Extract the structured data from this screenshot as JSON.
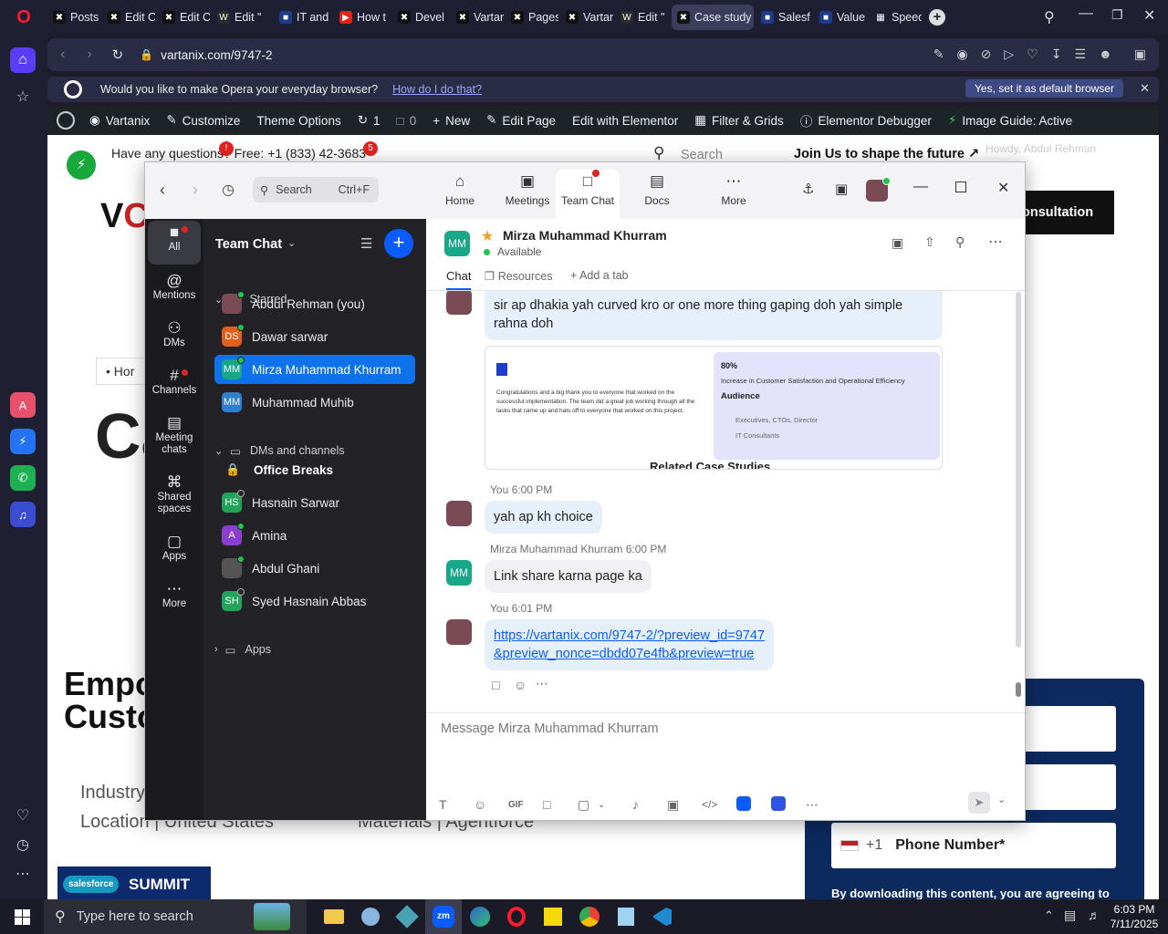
{
  "browser": {
    "tabs": [
      {
        "label": "Posts",
        "icon": "x-icon"
      },
      {
        "label": "Edit C",
        "icon": "x-icon"
      },
      {
        "label": "Edit C",
        "icon": "x-icon"
      },
      {
        "label": "Edit \"",
        "icon": "wordpress-icon"
      },
      {
        "label": "IT and",
        "icon": "page-icon"
      },
      {
        "label": "How t",
        "icon": "youtube-icon"
      },
      {
        "label": "Devel",
        "icon": "x-icon"
      },
      {
        "label": "Vartar",
        "icon": "x-icon"
      },
      {
        "label": "Pages",
        "icon": "x-icon"
      },
      {
        "label": "Vartar",
        "icon": "x-icon"
      },
      {
        "label": "Edit \"",
        "icon": "wordpress-icon"
      },
      {
        "label": "Case study",
        "icon": "x-icon"
      },
      {
        "label": "Salesf",
        "icon": "page-icon"
      },
      {
        "label": "Value",
        "icon": "page-icon"
      },
      {
        "label": "Speed",
        "icon": "grid-icon"
      }
    ],
    "url": "vartanix.com/9747-2",
    "banner_text": "Would you like to make Opera your everyday browser?",
    "banner_link": "How do I do that?",
    "banner_button": "Yes, set it as default browser"
  },
  "wp_admin": {
    "items": [
      "Vartanix",
      "Customize",
      "Theme Options",
      "1",
      "0",
      "New",
      "Edit Page",
      "Edit with Elementor",
      "Filter & Grids",
      "Elementor Debugger",
      "Image Guide: Active"
    ]
  },
  "site": {
    "top_text": "Have any questions? Free: +1 (833) 4",
    "phone_tail": "2-3683",
    "badge_1": "!",
    "badge_2": "5",
    "search_placeholder": "Search",
    "join": "Join Us to shape the future",
    "howdy": "Howdy, Abdul Rehman",
    "consultation": "onsultation",
    "home": "Hor",
    "big_c": "Ca",
    "empo": "Empo",
    "custo": "Custo",
    "industry": "Industry",
    "location": "Location | United States",
    "materials": "Materials | Agentforce",
    "phone_prefix": "+1",
    "phone_label": "Phone Number*",
    "disclaimer": "By downloading this content, you are agreeing to",
    "summit_brand": "salesforce",
    "summit": "SUMMIT"
  },
  "zoom": {
    "search_placeholder": "Search",
    "search_shortcut": "Ctrl+F",
    "nav": [
      {
        "label": "Home",
        "icon": "home-icon"
      },
      {
        "label": "Meetings",
        "icon": "video-icon"
      },
      {
        "label": "Team Chat",
        "icon": "chat-icon"
      },
      {
        "label": "Docs",
        "icon": "docs-icon"
      },
      {
        "label": "More",
        "icon": "more-icon"
      }
    ],
    "rail": [
      {
        "label": "All",
        "icon": "chat-bubble-icon"
      },
      {
        "label": "Mentions",
        "icon": "at-icon"
      },
      {
        "label": "DMs",
        "icon": "people-icon"
      },
      {
        "label": "Channels",
        "icon": "hash-icon"
      },
      {
        "label": "Meeting chats",
        "icon": "calendar-icon"
      },
      {
        "label": "Shared spaces",
        "icon": "share-icon"
      },
      {
        "label": "Apps",
        "icon": "apps-icon"
      },
      {
        "label": "More",
        "icon": "more-icon"
      }
    ],
    "list_title": "Team Chat",
    "starred": "Starred",
    "starred_items": [
      {
        "name": "Abdul Rehman (you)",
        "initials": "",
        "color": "#7a4b54"
      },
      {
        "name": "Dawar sarwar",
        "initials": "DS",
        "color": "#e0601c"
      },
      {
        "name": "Mirza Muhammad Khurram",
        "initials": "MM",
        "color": "#18a889"
      },
      {
        "name": "Muhammad Muhib",
        "initials": "MM",
        "color": "#2f7fd0"
      }
    ],
    "dms_header": "DMs and channels",
    "dm_items": [
      {
        "name": "Office Breaks",
        "initials": "",
        "color": ""
      },
      {
        "name": "Hasnain Sarwar",
        "initials": "HS",
        "color": "#21a35a"
      },
      {
        "name": "Amina",
        "initials": "A",
        "color": "#8a3fd1"
      },
      {
        "name": "Abdul Ghani",
        "initials": "",
        "color": "#555555"
      },
      {
        "name": "Syed Hasnain Abbas",
        "initials": "SH",
        "color": "#21a35a"
      }
    ],
    "apps": "Apps",
    "contact": {
      "name": "Mirza Muhammad Khurram",
      "initials": "MM",
      "status": "Available"
    },
    "tabs": {
      "chat": "Chat",
      "resources": "Resources",
      "add": "Add a tab"
    },
    "messages": {
      "m1": "sir ap dhakia yah curved kro or one more thing gaping doh yah simple rahna doh",
      "card_stat": "80%",
      "card_stat_text": "Increase in Customer Satisfaction and Operational Efficiency",
      "card_audience": "Audience",
      "card_aud1": "Executives, CTOs, Director",
      "card_aud2": "IT Consultants",
      "card_quote": "Congratulations and a big thank you to everyone that worked on the successful implementation. The team did a great job working through all the tasks that came up and hats off to everyone that worked on this project.",
      "card_related": "Related Case Studies",
      "m2_meta": "You 6:00 PM",
      "m2": "yah ap kh choice",
      "m3_meta_name": "Mirza Muhammad Khurram",
      "m3_meta_time": "6:00 PM",
      "m3": "Link share karna page ka",
      "m4_meta": "You 6:01 PM",
      "m4_line1": "https://vartanix.com/9747-2/?preview_id=9747",
      "m4_line2": "&preview_nonce=dbdd07e4fb&preview=true"
    },
    "composer_placeholder": "Message Mirza Muhammad Khurram",
    "composer_gif": "GIF"
  },
  "taskbar": {
    "search_placeholder": "Type here to search",
    "time": "6:03 PM",
    "date": "7/11/2025"
  }
}
